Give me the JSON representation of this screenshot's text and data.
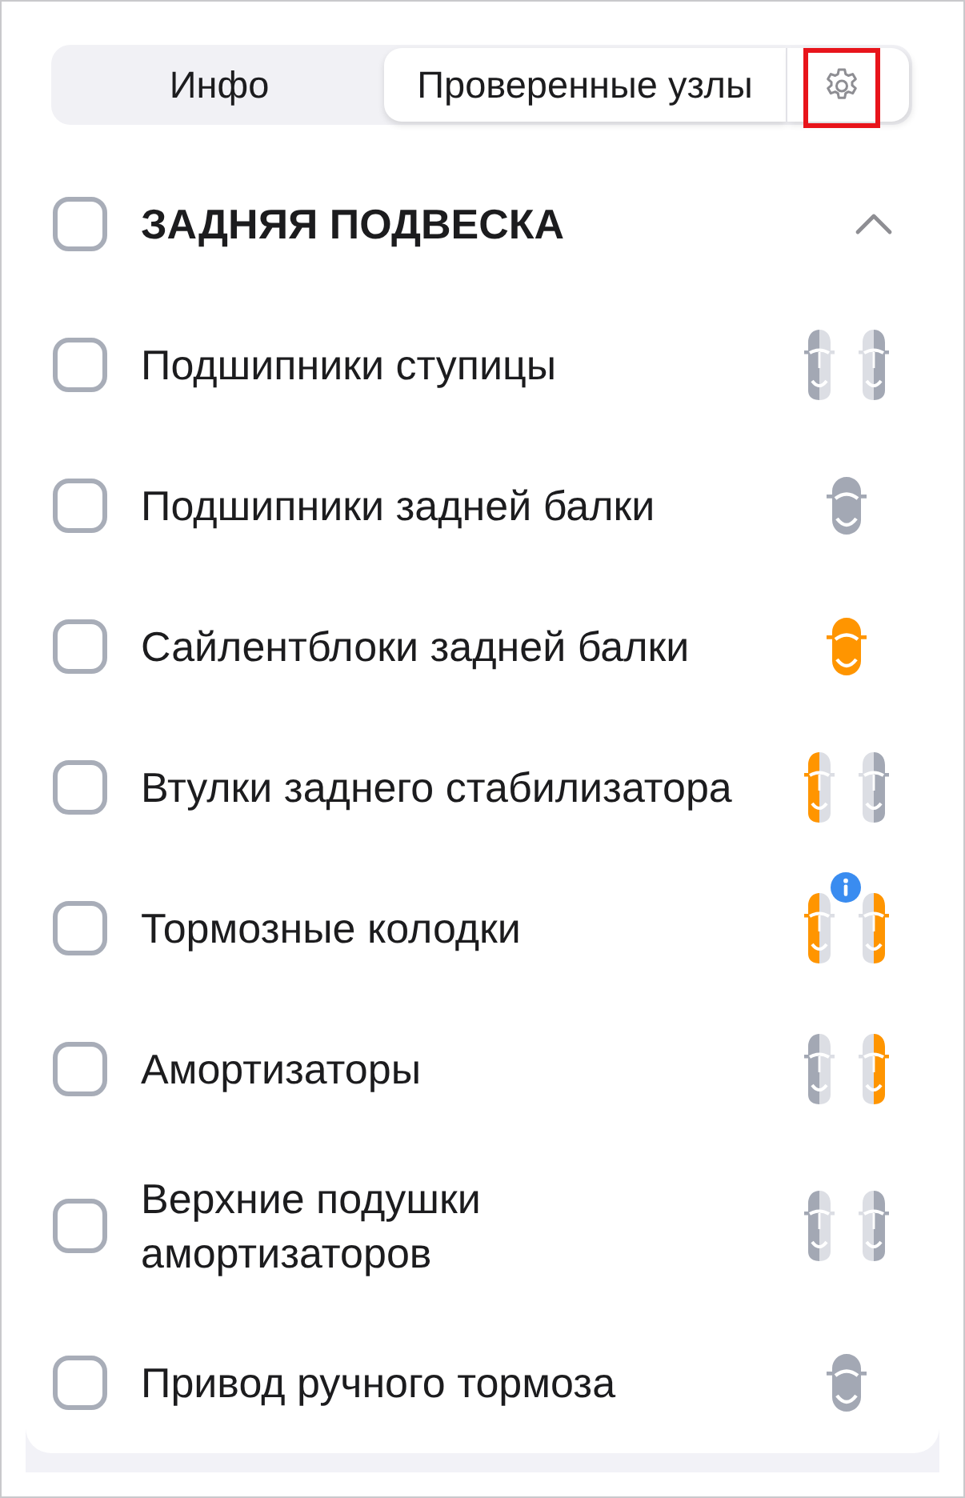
{
  "tabs": [
    {
      "label": "Инфо",
      "selected": false
    },
    {
      "label": "Проверенные узлы",
      "selected": true
    }
  ],
  "settings_button": {
    "highlighted": true
  },
  "section": {
    "title": "ЗАДНЯЯ ПОДВЕСКА",
    "checked": false,
    "expanded": true,
    "items": [
      {
        "label": "Подшипники ступицы",
        "checked": false,
        "info": false,
        "indicator": {
          "kind": "pair",
          "cars": [
            {
              "halves": [
                {
                  "color": "#a3a8b4"
                },
                {
                  "color": "#dcdee4"
                }
              ]
            },
            {
              "halves": [
                {
                  "color": "#dcdee4"
                },
                {
                  "color": "#a3a8b4"
                }
              ]
            }
          ]
        }
      },
      {
        "label": "Подшипники задней балки",
        "checked": false,
        "info": false,
        "indicator": {
          "kind": "single",
          "color": "#a3a8b4"
        }
      },
      {
        "label": "Сайлентблоки задней балки",
        "checked": false,
        "info": false,
        "indicator": {
          "kind": "single",
          "color": "#ff9500"
        }
      },
      {
        "label": "Втулки заднего стабилизатора",
        "checked": false,
        "info": false,
        "indicator": {
          "kind": "pair",
          "cars": [
            {
              "halves": [
                {
                  "color": "#ff9500"
                },
                {
                  "color": "#dcdee4"
                }
              ]
            },
            {
              "halves": [
                {
                  "color": "#dcdee4"
                },
                {
                  "color": "#a3a8b4"
                }
              ]
            }
          ]
        }
      },
      {
        "label": "Тормозные колодки",
        "checked": false,
        "info": true,
        "indicator": {
          "kind": "pair",
          "cars": [
            {
              "halves": [
                {
                  "color": "#ff9500"
                },
                {
                  "color": "#dcdee4"
                }
              ]
            },
            {
              "halves": [
                {
                  "color": "#dcdee4"
                },
                {
                  "color": "#ff9500"
                }
              ]
            }
          ]
        }
      },
      {
        "label": "Амортизаторы",
        "checked": false,
        "info": false,
        "indicator": {
          "kind": "pair",
          "cars": [
            {
              "halves": [
                {
                  "color": "#a3a8b4"
                },
                {
                  "color": "#dcdee4"
                }
              ]
            },
            {
              "halves": [
                {
                  "color": "#dcdee4"
                },
                {
                  "color": "#ff9500"
                }
              ]
            }
          ]
        }
      },
      {
        "label": "Верхние подушки амортизаторов",
        "checked": false,
        "info": false,
        "indicator": {
          "kind": "pair",
          "cars": [
            {
              "halves": [
                {
                  "color": "#a3a8b4"
                },
                {
                  "color": "#dcdee4"
                }
              ]
            },
            {
              "halves": [
                {
                  "color": "#dcdee4"
                },
                {
                  "color": "#a3a8b4"
                }
              ]
            }
          ]
        }
      },
      {
        "label": "Привод ручного тормоза",
        "checked": false,
        "info": false,
        "indicator": {
          "kind": "single",
          "color": "#a3a8b4"
        }
      }
    ]
  }
}
